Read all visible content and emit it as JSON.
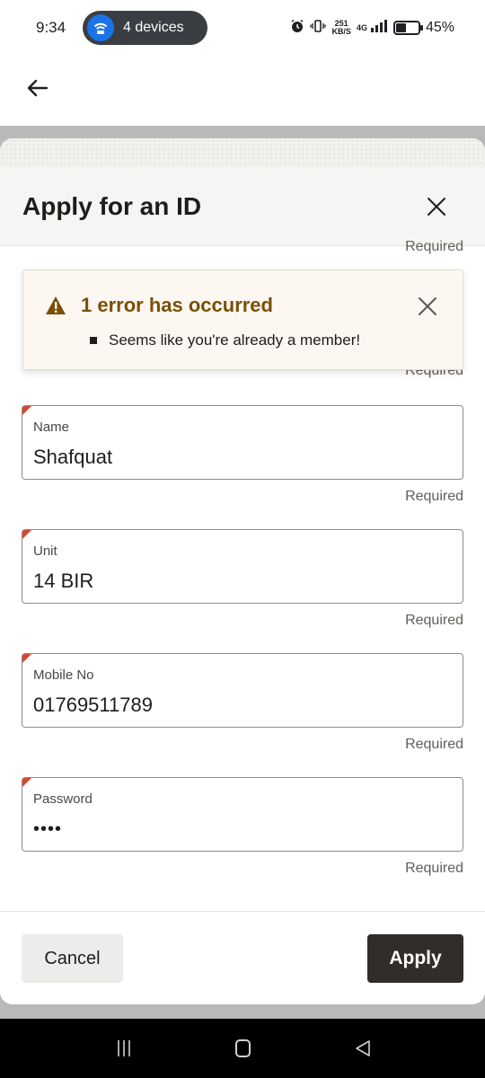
{
  "status_bar": {
    "time": "9:34",
    "hotspot_label": "4 devices",
    "net_speed_value": "251",
    "net_speed_unit": "KB/S",
    "network_type": "4G",
    "battery_percent": "45%",
    "battery_level": 0.45
  },
  "dialog": {
    "title": "Apply for an ID",
    "required_text": "Required",
    "error": {
      "title": "1 error has occurred",
      "items": [
        "Seems like you're already a member!"
      ]
    },
    "fields": [
      {
        "label": "Name",
        "value": "Shafquat"
      },
      {
        "label": "Unit",
        "value": "14 BIR"
      },
      {
        "label": "Mobile No",
        "value": "01769511789"
      },
      {
        "label": "Password",
        "value": "••••"
      }
    ],
    "cancel_label": "Cancel",
    "apply_label": "Apply"
  },
  "colors": {
    "accent_dark": "#312d2a",
    "error_title": "#7a4f08",
    "error_flag": "#d8452f",
    "hotspot_icon": "#1a73e8"
  },
  "icons": {
    "hotspot": "wifi-hotspot-icon",
    "back": "arrow-left-icon",
    "close": "close-icon",
    "warning": "warning-triangle-icon"
  }
}
